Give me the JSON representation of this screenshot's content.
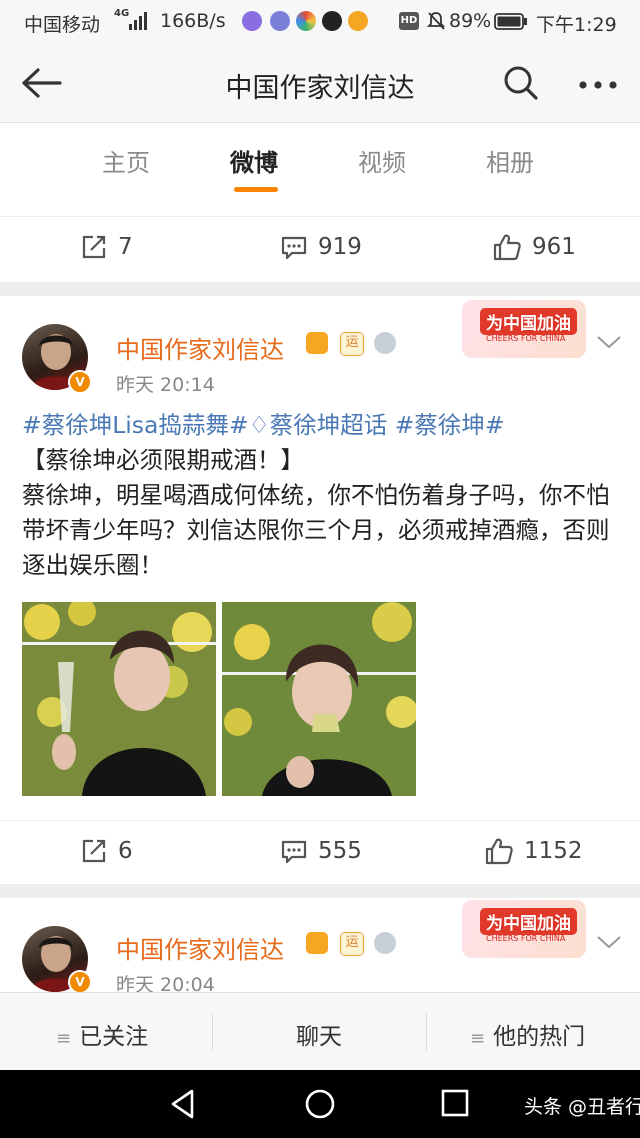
{
  "status_bar": {
    "carrier": "中国移动",
    "net": "4G",
    "speed": "166B/s",
    "hd": "HD",
    "battery": "89%",
    "time": "下午1:29"
  },
  "nav": {
    "title": "中国作家刘信达"
  },
  "tabs": [
    {
      "label": "主页"
    },
    {
      "label": "微博"
    },
    {
      "label": "视频"
    },
    {
      "label": "相册"
    }
  ],
  "prev_post": {
    "reposts": "7",
    "comments": "919",
    "likes": "961"
  },
  "post1": {
    "user": "中国作家刘信达",
    "badge_text": "运",
    "time": "昨天 20:14",
    "cheer_main": "为中国加油",
    "cheer_sub": "CHEERS FOR CHINA",
    "tag1": "#蔡徐坤Lisa捣蒜舞#",
    "tag2": "蔡徐坤超话",
    "tag3": "#蔡徐坤#",
    "headline": "【蔡徐坤必须限期戒酒！】",
    "body": "蔡徐坤，明星喝酒成何体统，你不怕伤着身子吗，你不怕带坏青少年吗？刘信达限你三个月，必须戒掉酒瘾，否则逐出娱乐圈！",
    "reposts": "6",
    "comments": "555",
    "likes": "1152"
  },
  "post2": {
    "user": "中国作家刘信达",
    "badge_text": "运",
    "time": "昨天 20:04",
    "cheer_main": "为中国加油",
    "cheer_sub": "CHEERS FOR CHINA"
  },
  "bottom_bar": {
    "follow": "已关注",
    "chat": "聊天",
    "hot": "他的热门"
  },
  "watermark": "头条 @丑者行",
  "colors": {
    "accent": "#ff8200",
    "username": "#e86b1c",
    "hashtag": "#4a78b5"
  }
}
